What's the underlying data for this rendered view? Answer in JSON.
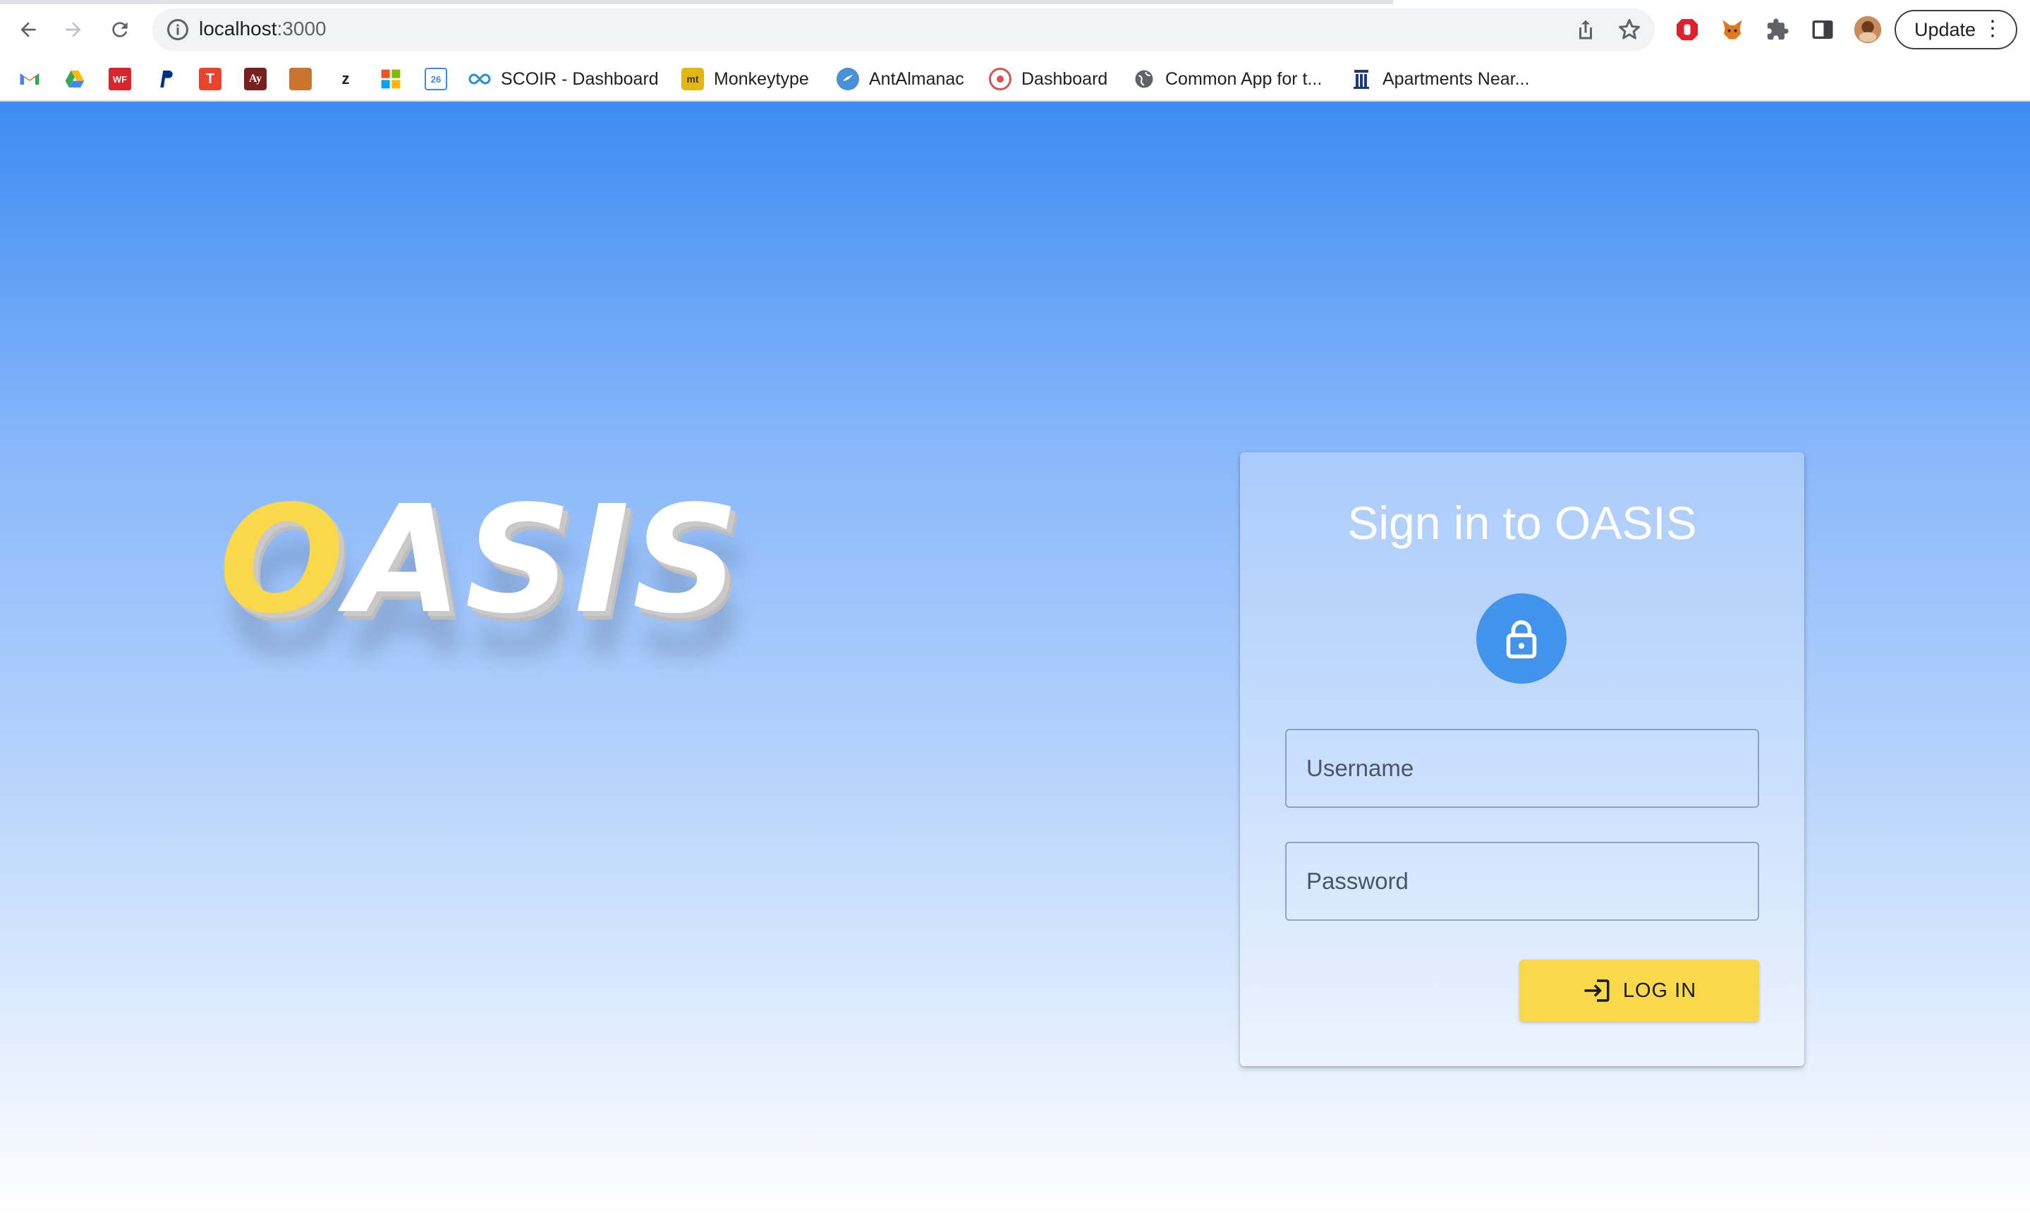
{
  "browser": {
    "url_host": "localhost",
    "url_port": ":3000",
    "update_label": "Update"
  },
  "bookmarks": [
    {
      "label": "SCOIR - Dashboard",
      "icon": "infinity-icon"
    },
    {
      "label": "Monkeytype",
      "icon": "monkeytype-icon"
    },
    {
      "label": "AntAlmanac",
      "icon": "antalmanac-icon"
    },
    {
      "label": "Dashboard",
      "icon": "dashboard-icon"
    },
    {
      "label": "Common App for t...",
      "icon": "globe-icon"
    },
    {
      "label": "Apartments Near...",
      "icon": "building-icon"
    }
  ],
  "logo": {
    "first_letter": "O",
    "rest": "ASIS"
  },
  "login": {
    "title": "Sign in to OASIS",
    "username_placeholder": "Username",
    "password_placeholder": "Password",
    "button_label": "LOG IN"
  },
  "colors": {
    "accent_yellow": "#f9d849",
    "lock_blue": "#4293ec",
    "gradient_top": "#3d8bf3"
  }
}
